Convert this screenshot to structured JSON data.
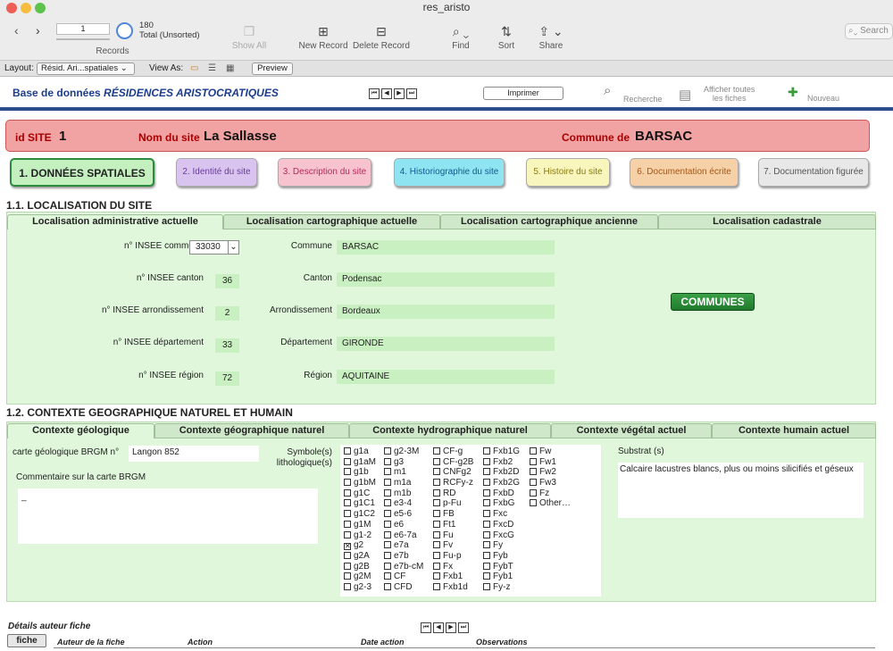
{
  "window": {
    "title": "res_aristo"
  },
  "toolbar": {
    "record_current": "1",
    "record_count": "180",
    "record_status": "Total (Unsorted)",
    "records_label": "Records",
    "show_all": "Show All",
    "new_record": "New Record",
    "delete_record": "Delete Record",
    "find": "Find",
    "sort": "Sort",
    "share": "Share",
    "search_placeholder": "Search"
  },
  "layoutbar": {
    "layout_label": "Layout:",
    "layout_value": "Résid. Ari...spatiales",
    "view_as": "View As:",
    "preview": "Preview"
  },
  "header": {
    "title_prefix": "Base de données ",
    "title_italic": "RÉSIDENCES ARISTOCRATIQUES",
    "print": "Imprimer",
    "search": "Recherche",
    "show_all_1": "Afficher toutes",
    "show_all_2": "les fiches",
    "new": "Nouveau"
  },
  "site": {
    "id_label": "id SITE",
    "id_value": "1",
    "name_label": "Nom du site",
    "name_value": "La Sallasse",
    "commune_label": "Commune de",
    "commune_value": "BARSAC"
  },
  "tabs": [
    {
      "label": "1. DONNÉES SPATIALES",
      "color": "#c4f0c0"
    },
    {
      "label": "2. Identité du site",
      "color": "#d9c4f0"
    },
    {
      "label": "3. Description du site",
      "color": "#f7c3cf"
    },
    {
      "label": "4. Historiographie du site",
      "color": "#8fe4f1"
    },
    {
      "label": "5. Histoire du site",
      "color": "#f8f5bd"
    },
    {
      "label": "6. Documentation écrite",
      "color": "#f6d0a6"
    },
    {
      "label": "7. Documentation figurée",
      "color": "#e8e8e8"
    }
  ],
  "loc": {
    "title": "1.1. LOCALISATION DU SITE",
    "subtabs": [
      "Localisation administrative actuelle",
      "Localisation cartographique actuelle",
      "Localisation cartographique ancienne",
      "Localisation cadastrale"
    ],
    "rows": [
      {
        "insee_label": "n° INSEE commune",
        "insee_value": "33030",
        "name_label": "Commune",
        "name_value": "BARSAC"
      },
      {
        "insee_label": "n° INSEE canton",
        "insee_value": "36",
        "name_label": "Canton",
        "name_value": "Podensac"
      },
      {
        "insee_label": "n° INSEE arrondissement",
        "insee_value": "2",
        "name_label": "Arrondissement",
        "name_value": "Bordeaux"
      },
      {
        "insee_label": "n° INSEE département",
        "insee_value": "33",
        "name_label": "Département",
        "name_value": "GIRONDE"
      },
      {
        "insee_label": "n° INSEE région",
        "insee_value": "72",
        "name_label": "Région",
        "name_value": "AQUITAINE"
      }
    ],
    "communes_button": "COMMUNES"
  },
  "ctx": {
    "title": "1.2. CONTEXTE GEOGRAPHIQUE NATUREL ET HUMAIN",
    "subtabs": [
      "Contexte géologique",
      "Contexte géographique naturel",
      "Contexte hydrographique naturel",
      "Contexte végétal actuel",
      "Contexte humain actuel"
    ],
    "brgm_label": "carte géologique BRGM n°",
    "brgm_value": "Langon 852",
    "symbol_label_1": "Symbole(s)",
    "symbol_label_2": "lithologique(s)",
    "comment_label": "Commentaire sur la carte BRGM",
    "comment_value": "_",
    "substrat_label": "Substrat (s)",
    "substrat_value": "Calcaire lacustres blancs, plus ou moins silicifiés et géseux",
    "columns": [
      [
        "g1a",
        "g1aM",
        "g1b",
        "g1bM",
        "g1C",
        "g1C1",
        "g1C2",
        "g1M",
        "g1-2",
        "g2",
        "g2A",
        "g2B",
        "g2M",
        "g2-3"
      ],
      [
        "g2-3M",
        "g3",
        "m1",
        "m1a",
        "m1b",
        "e3-4",
        "e5-6",
        "e6",
        "e6-7a",
        "e7a",
        "e7b",
        "e7b-cM",
        "CF",
        "CFD"
      ],
      [
        "CF-g",
        "CF-g2B",
        "CNFg2",
        "RCFy-z",
        "RD",
        "p-Fu",
        "FB",
        "Ft1",
        "Fu",
        "Fv",
        "Fu-p",
        "Fx",
        "Fxb1",
        "Fxb1d"
      ],
      [
        "Fxb1G",
        "Fxb2",
        "Fxb2D",
        "Fxb2G",
        "FxbD",
        "FxbG",
        "Fxc",
        "FxcD",
        "FxcG",
        "Fy",
        "Fyb",
        "FybT",
        "Fyb1",
        "Fy-z"
      ],
      [
        "Fw",
        "Fw1",
        "Fw2",
        "Fw3",
        "Fz",
        "Other…"
      ]
    ],
    "checked": "g2"
  },
  "footer": {
    "title": "Détails auteur fiche",
    "fiche_button": "fiche",
    "col_author": "Auteur de la fiche",
    "col_action": "Action",
    "col_date": "Date action",
    "col_obs": "Observations"
  }
}
